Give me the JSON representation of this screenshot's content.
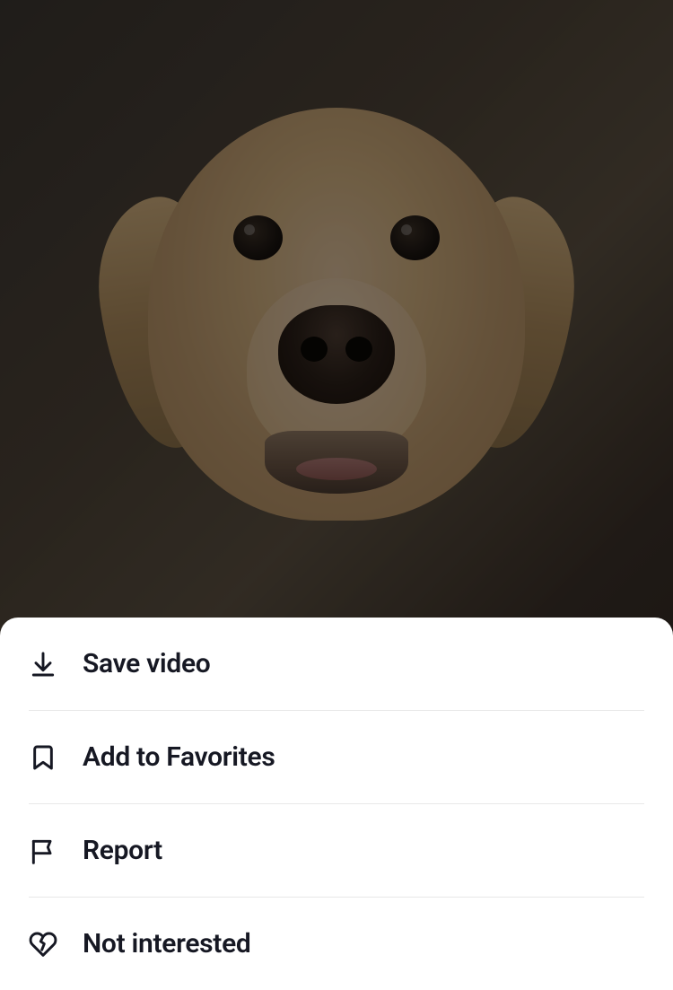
{
  "video": {
    "subject": "golden-retriever-dog-closeup"
  },
  "actionSheet": {
    "items": [
      {
        "icon": "download-icon",
        "label": "Save video"
      },
      {
        "icon": "bookmark-icon",
        "label": "Add to Favorites"
      },
      {
        "icon": "flag-icon",
        "label": "Report"
      },
      {
        "icon": "broken-heart-icon",
        "label": "Not interested"
      }
    ]
  },
  "colors": {
    "sheet_bg": "#ffffff",
    "text": "#161823",
    "divider": "#e8e8e8",
    "icon": "#161823"
  }
}
